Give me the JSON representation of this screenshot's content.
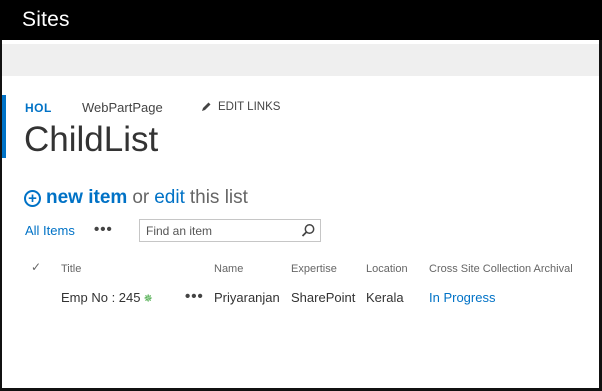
{
  "suite": {
    "title": "Sites"
  },
  "nav": {
    "home": "HOL",
    "page": "WebPartPage",
    "edit_links": "EDIT LINKS"
  },
  "page": {
    "title": "ChildList"
  },
  "actions": {
    "new_item": "new item",
    "or": "or",
    "edit": "edit",
    "this_list": "this list"
  },
  "view": {
    "current": "All Items",
    "more": "•••"
  },
  "search": {
    "placeholder": "Find an item"
  },
  "table": {
    "columns": [
      "Title",
      "Name",
      "Expertise",
      "Location",
      "Cross Site Collection Archival"
    ],
    "rows": [
      {
        "title": "Emp No : 245",
        "new_marker": "✵",
        "more": "•••",
        "name": "Priyaranjan",
        "expertise": "SharePoint",
        "location": "Kerala",
        "status": "In Progress"
      }
    ]
  },
  "colors": {
    "accent": "#0072c6",
    "suite_bar": "#000000",
    "ribbon": "#efefef"
  },
  "icons": [
    "pencil-icon",
    "plus-circle-icon",
    "search-icon",
    "check-icon"
  ]
}
